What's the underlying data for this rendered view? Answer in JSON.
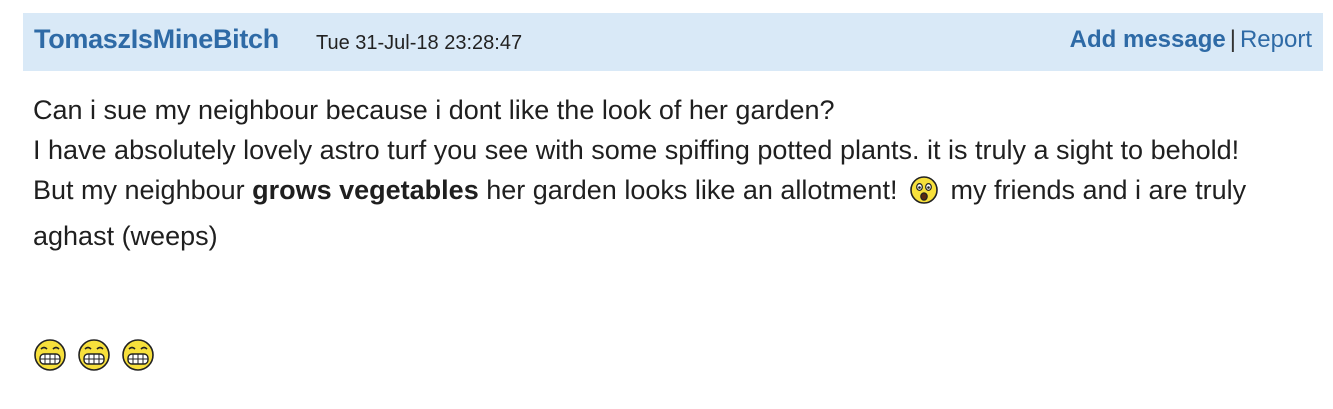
{
  "header": {
    "username": "TomaszIsMineBitch",
    "timestamp": "Tue 31-Jul-18 23:28:47",
    "add_message": "Add message",
    "separator": "|",
    "report": "Report"
  },
  "body": {
    "line1": "Can i sue my neighbour because i dont like the look of her garden?",
    "line2": "I have absolutely lovely astro turf you see with some spiffing potted plants. it is truly a sight to behold!",
    "line3_pre": "But my neighbour ",
    "line3_bold": "grows vegetables",
    "line3_mid": " her garden looks like an allotment! ",
    "line3_post": " my friends and i are truly aghast (weeps)"
  },
  "emoji": {
    "inline": "shocked-face-icon",
    "trailing": [
      "grinning-teeth-icon",
      "grinning-teeth-icon",
      "grinning-teeth-icon"
    ]
  }
}
